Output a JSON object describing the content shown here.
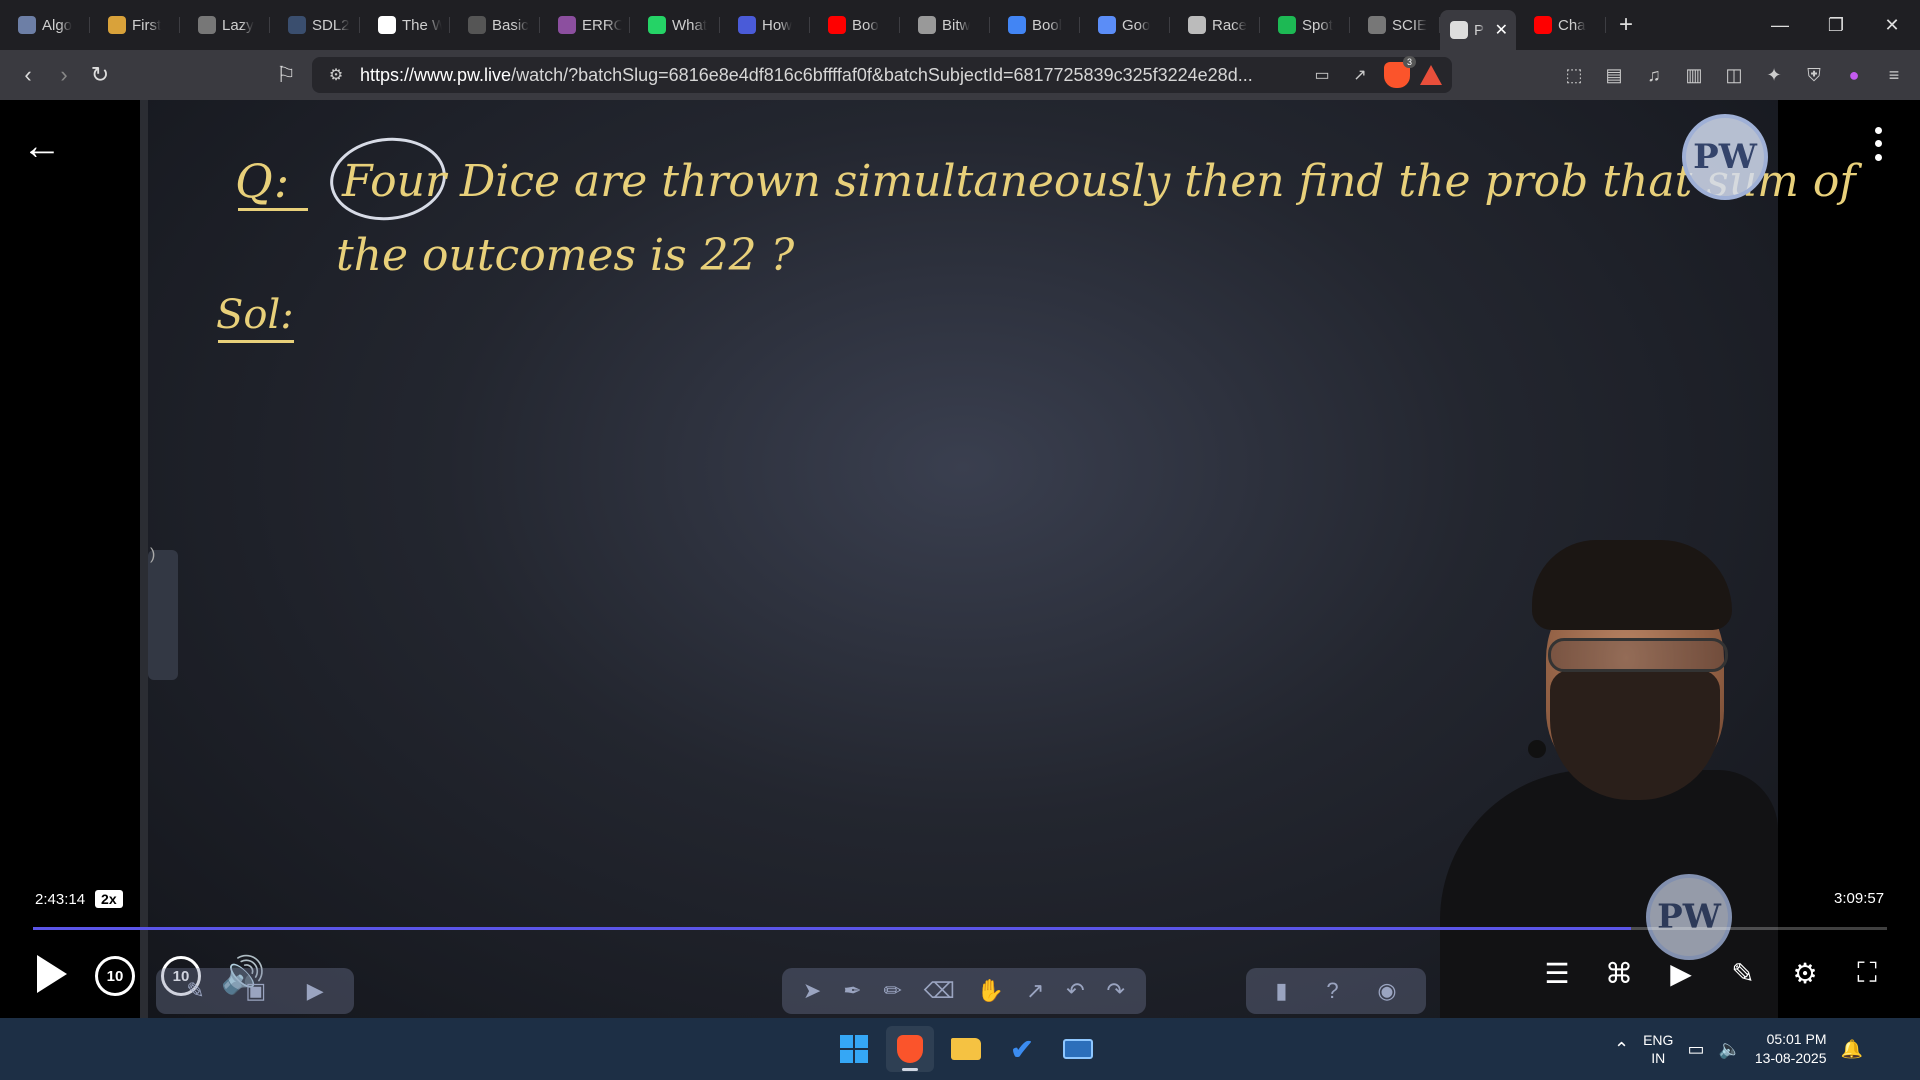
{
  "browser": {
    "tabs": [
      {
        "label": "Algo",
        "icon": "algo-icon",
        "color": "#6d7fa6"
      },
      {
        "label": "First",
        "icon": "first-icon",
        "color": "#d9a23a"
      },
      {
        "label": "Lazy",
        "icon": "globe-icon",
        "color": "#777"
      },
      {
        "label": "SDL2",
        "icon": "sdl-icon",
        "color": "#3a4e6e"
      },
      {
        "label": "The W",
        "icon": "w3-icon",
        "color": "#fff"
      },
      {
        "label": "Basic",
        "icon": "basic-icon",
        "color": "#555"
      },
      {
        "label": "ERRO",
        "icon": "err-icon",
        "color": "#8c4f9f"
      },
      {
        "label": "What",
        "icon": "whatsapp-icon",
        "color": "#25d366"
      },
      {
        "label": "How",
        "icon": "how-icon",
        "color": "#4a5bd8"
      },
      {
        "label": "Boo",
        "icon": "youtube-icon",
        "color": "#ff0000"
      },
      {
        "label": "Bitw",
        "icon": "bitw-icon",
        "color": "#999"
      },
      {
        "label": "Bool",
        "icon": "google-icon",
        "color": "#4285f4"
      },
      {
        "label": "Goo",
        "icon": "gemini-icon",
        "color": "#5b8df7"
      },
      {
        "label": "Race",
        "icon": "chatgpt-icon",
        "color": "#bbb"
      },
      {
        "label": "Spot",
        "icon": "spotify-icon",
        "color": "#1db954"
      },
      {
        "label": "SCIE",
        "icon": "globe-icon",
        "color": "#777"
      },
      {
        "label": "P",
        "icon": "speaker-icon",
        "color": "#ddd",
        "active": true
      },
      {
        "label": "Cha",
        "icon": "youtube-icon",
        "color": "#ff0000"
      }
    ],
    "url_host": "https://www.pw.live",
    "url_path": "/watch/?batchSlug=6816e8e4df816c6bffffaf0f&batchSubjectId=6817725839c325f3224e28d...",
    "shield_count": "3"
  },
  "video": {
    "board_text": {
      "q_label": "Q:",
      "line1": "Four Dice are thrown simultaneously then find the prob that sum of",
      "line2": "the outcomes is 22 ?",
      "sol_label": "Sol:"
    },
    "logo_text": "PW",
    "current_time": "2:43:14",
    "speed": "2x",
    "duration": "3:09:57",
    "progress": 0.862,
    "skip_back": "10",
    "skip_forward": "10"
  },
  "taskbar": {
    "lang_line1": "ENG",
    "lang_line2": "IN",
    "time": "05:01 PM",
    "date": "13-08-2025"
  }
}
